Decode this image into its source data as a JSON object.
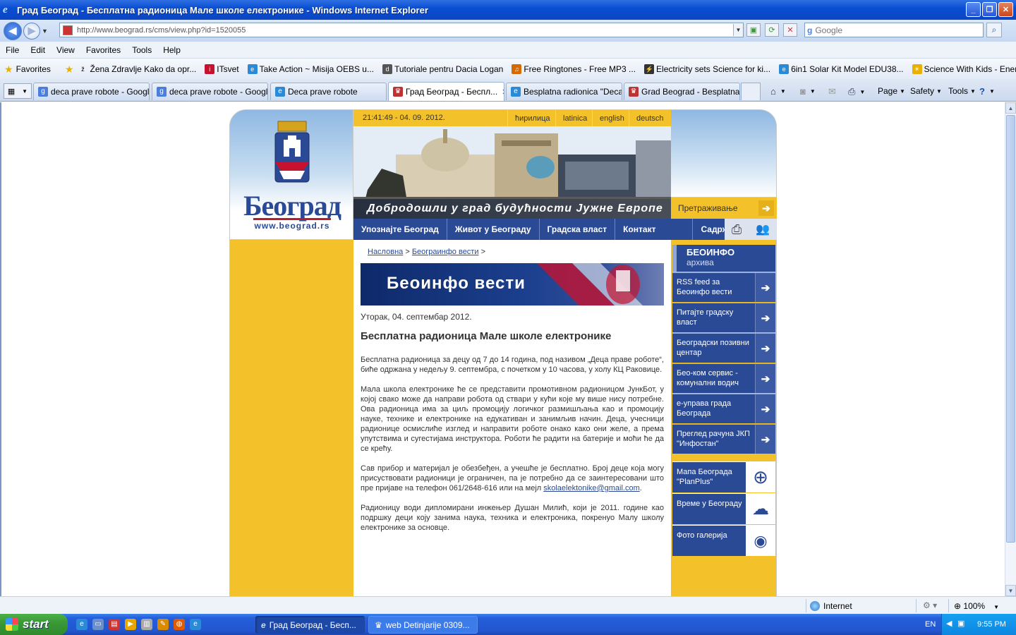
{
  "window": {
    "title": "Град Београд - Бесплатна радионица Мале школе електронике - Windows Internet Explorer"
  },
  "address": {
    "url": "http://www.beograd.rs/cms/view.php?id=1520055",
    "search_placeholder": "Google"
  },
  "menu": [
    "File",
    "Edit",
    "View",
    "Favorites",
    "Tools",
    "Help"
  ],
  "favorites_bar": {
    "label": "Favorites",
    "items": [
      "Žena  Zdravlje  Kako da opr...",
      "ITsvet",
      "Take Action ~ Misija OEBS u...",
      "Tutoriale pentru Dacia Logan",
      "Free Ringtones - Free MP3 ...",
      "Electricity sets Science for ki...",
      "6in1 Solar Kit  Model EDU38...",
      "Science With Kids - Energy ..."
    ]
  },
  "tabs": [
    "deca prave robote - Googl...",
    "deca prave robote - Googl...",
    "Deca prave robote",
    "Град Београд - Беспл...",
    "Besplatna radionica \"Deca ...",
    "Grad Beograd - Besplatna ..."
  ],
  "command_bar": {
    "page": "Page",
    "safety": "Safety",
    "tools": "Tools"
  },
  "site": {
    "logo_text": "Београд",
    "logo_url": "www.beograd.rs",
    "datetime": "21:41:49 - 04. 09. 2012.",
    "languages": [
      "ћирилица",
      "latinica",
      "english",
      "deutsch"
    ],
    "slogan": "Добродошли у град будућности Јужне Европе",
    "search_label": "Претраживање",
    "nav": [
      "Упознајте Београд",
      "Живот у Београду",
      "Градска власт",
      "Контакт",
      "Садржај"
    ],
    "breadcrumb": {
      "home": "Насловна",
      "section": "Београинфо вести",
      "sep": ">"
    },
    "news_banner": "Беоинфо вести",
    "article": {
      "date": "Уторак, 04. септембар 2012.",
      "title": "Бесплатна радионица Мале школе електронике",
      "p1": "Бесплатна радионица за децу од 7 до 14 година, под називом „Деца праве роботе“, биће одржана у недељу 9. септембра, с почетком у 10 часова, у холу КЦ Раковице.",
      "p2": "Мала школа електронике ће се представити промотивном радионицом ЈункБот, у којој свако може да направи робота од ствари у кући које му више нису потребне. Ова радионица има за циљ промоцију логичког размишљања као и промоцију науке, технике и електронике на едукативан и занимљив начин. Деца, учесници радионице осмислиће изглед и направити роботе онако како они желе, а према упутствима и сугестијама инструктора. Роботи ће радити на батерије и моћи ће да се крећу.",
      "p3": "Сав прибор и материјал је обезбеђен, а учешће је бесплатно. Број деце која могу присуствовати радионици је ограничен, па је потребно да се заинтересовани што пре пријаве на телефон 061/2648-616 или на мејл",
      "p3_email": "skolaelektonike@gmail.com",
      "p3_end": ".",
      "p4": "Радионицу води дипломирани инжењер Душан Милић, који је 2011. године као подршку деци коју занима наука, техника и електроника, покренуо Малу школу електронике за основце."
    },
    "sidebar": {
      "head_title": "БЕОИНФО",
      "head_sub": "архива",
      "items": [
        "RSS feed за Беоинфо вести",
        "Питајте градску власт",
        "Београдски позивни центар",
        "Бео-ком сервис - комунални водич",
        "е-управа града Београда",
        "Преглед рачуна ЈКП \"Инфостан\""
      ],
      "items2": [
        "Мапа Београда \"PlanPlus\"",
        "Време у Београду",
        "Фото галерија"
      ]
    }
  },
  "status": {
    "zone": "Internet",
    "zoom": "100%"
  },
  "taskbar": {
    "start": "start",
    "tasks": [
      "Град Београд - Бесп...",
      "web Detinjarije 0309..."
    ],
    "lang": "EN",
    "time": "9:55 PM"
  }
}
